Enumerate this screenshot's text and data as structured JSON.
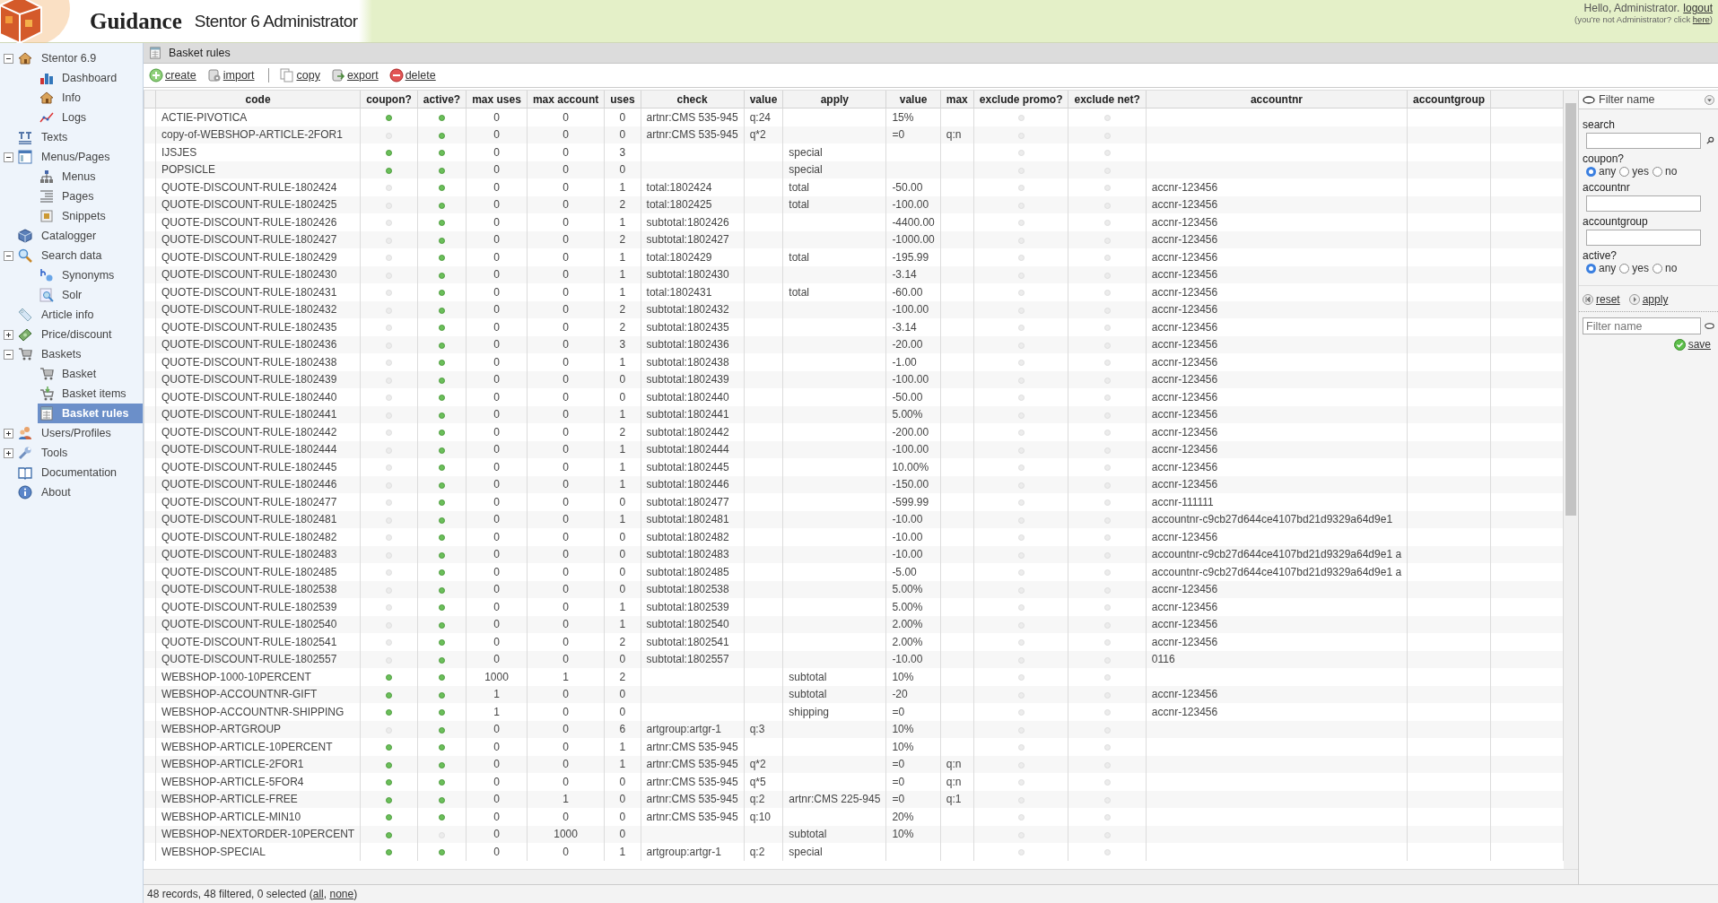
{
  "header": {
    "brand": "Guidance",
    "product": "Stentor 6 Administrator",
    "greeting": "Hello, Administrator.",
    "logout": "logout",
    "switch_user": {
      "before": "(you're not Administrator? click ",
      "link": "here",
      "after": ")"
    }
  },
  "sidebar": {
    "items": [
      {
        "label": "Stentor 6.9",
        "expanded": true,
        "children": [
          {
            "label": "Dashboard",
            "selected": false
          },
          {
            "label": "Info",
            "selected": false
          },
          {
            "label": "Logs",
            "selected": false
          }
        ]
      },
      {
        "label": "Texts"
      },
      {
        "label": "Menus/Pages",
        "expanded": true,
        "children": [
          {
            "label": "Menus",
            "selected": false
          },
          {
            "label": "Pages",
            "selected": false
          },
          {
            "label": "Snippets",
            "selected": false
          }
        ]
      },
      {
        "label": "Catalogger"
      },
      {
        "label": "Search data",
        "expanded": true,
        "children": [
          {
            "label": "Synonyms",
            "selected": false
          },
          {
            "label": "Solr",
            "selected": false
          }
        ]
      },
      {
        "label": "Article info"
      },
      {
        "label": "Price/discount",
        "expanded": false
      },
      {
        "label": "Baskets",
        "expanded": true,
        "children": [
          {
            "label": "Basket",
            "selected": false
          },
          {
            "label": "Basket items",
            "selected": false
          },
          {
            "label": "Basket rules",
            "selected": true
          }
        ]
      },
      {
        "label": "Users/Profiles",
        "expanded": false
      },
      {
        "label": "Tools",
        "expanded": false
      },
      {
        "label": "Documentation"
      },
      {
        "label": "About"
      }
    ]
  },
  "page": {
    "title": "Basket rules"
  },
  "toolbar": {
    "groups": [
      {
        "items": [
          {
            "label": "create"
          },
          {
            "label": "import"
          }
        ]
      },
      {
        "items": [
          {
            "label": "copy"
          },
          {
            "label": "export"
          },
          {
            "label": "delete"
          }
        ]
      }
    ]
  },
  "table": {
    "columns": [
      "code",
      "coupon?",
      "active?",
      "max uses",
      "max account",
      "uses",
      "check",
      "value",
      "apply",
      "value",
      "max",
      "exclude promo?",
      "exclude net?",
      "accountnr",
      "accountgroup"
    ],
    "rows": [
      {
        "code": "ACTIE-PIVOTICA",
        "coupon": true,
        "active": true,
        "max_uses": "0",
        "max_account": "0",
        "uses": "0",
        "check": "artnr:CMS 535-945",
        "value": "q:24",
        "apply_value": "15%",
        "exclude_promo": false,
        "exclude_net": false
      },
      {
        "code": "copy-of-WEBSHOP-ARTICLE-2FOR1",
        "coupon": false,
        "active": true,
        "max_uses": "0",
        "max_account": "0",
        "uses": "0",
        "check": "artnr:CMS 535-945",
        "value": "q*2",
        "apply_value": "=0",
        "max": "q:n",
        "exclude_promo": false,
        "exclude_net": false
      },
      {
        "code": "IJSJES",
        "coupon": true,
        "active": true,
        "max_uses": "0",
        "max_account": "0",
        "uses": "3",
        "apply": "special",
        "exclude_promo": false,
        "exclude_net": false
      },
      {
        "code": "POPSICLE",
        "coupon": true,
        "active": true,
        "max_uses": "0",
        "max_account": "0",
        "uses": "0",
        "apply": "special",
        "exclude_promo": false,
        "exclude_net": false
      },
      {
        "code": "QUOTE-DISCOUNT-RULE-1802424",
        "coupon": false,
        "active": true,
        "max_uses": "0",
        "max_account": "0",
        "uses": "1",
        "check": "total:1802424",
        "apply": "total",
        "apply_value": "-50.00",
        "exclude_promo": false,
        "exclude_net": false,
        "accountnr": "accnr-123456"
      },
      {
        "code": "QUOTE-DISCOUNT-RULE-1802425",
        "coupon": false,
        "active": true,
        "max_uses": "0",
        "max_account": "0",
        "uses": "2",
        "check": "total:1802425",
        "apply": "total",
        "apply_value": "-100.00",
        "exclude_promo": false,
        "exclude_net": false,
        "accountnr": "accnr-123456"
      },
      {
        "code": "QUOTE-DISCOUNT-RULE-1802426",
        "coupon": false,
        "active": true,
        "max_uses": "0",
        "max_account": "0",
        "uses": "1",
        "check": "subtotal:1802426",
        "apply_value": "-4400.00",
        "exclude_promo": false,
        "exclude_net": false,
        "accountnr": "accnr-123456"
      },
      {
        "code": "QUOTE-DISCOUNT-RULE-1802427",
        "coupon": false,
        "active": true,
        "max_uses": "0",
        "max_account": "0",
        "uses": "2",
        "check": "subtotal:1802427",
        "apply_value": "-1000.00",
        "exclude_promo": false,
        "exclude_net": false,
        "accountnr": "accnr-123456"
      },
      {
        "code": "QUOTE-DISCOUNT-RULE-1802429",
        "coupon": false,
        "active": true,
        "max_uses": "0",
        "max_account": "0",
        "uses": "1",
        "check": "total:1802429",
        "apply": "total",
        "apply_value": "-195.99",
        "exclude_promo": false,
        "exclude_net": false,
        "accountnr": "accnr-123456"
      },
      {
        "code": "QUOTE-DISCOUNT-RULE-1802430",
        "coupon": false,
        "active": true,
        "max_uses": "0",
        "max_account": "0",
        "uses": "1",
        "check": "subtotal:1802430",
        "apply_value": "-3.14",
        "exclude_promo": false,
        "exclude_net": false,
        "accountnr": "accnr-123456"
      },
      {
        "code": "QUOTE-DISCOUNT-RULE-1802431",
        "coupon": false,
        "active": true,
        "max_uses": "0",
        "max_account": "0",
        "uses": "1",
        "check": "total:1802431",
        "apply": "total",
        "apply_value": "-60.00",
        "exclude_promo": false,
        "exclude_net": false,
        "accountnr": "accnr-123456"
      },
      {
        "code": "QUOTE-DISCOUNT-RULE-1802432",
        "coupon": false,
        "active": true,
        "max_uses": "0",
        "max_account": "0",
        "uses": "2",
        "check": "subtotal:1802432",
        "apply_value": "-100.00",
        "exclude_promo": false,
        "exclude_net": false,
        "accountnr": "accnr-123456"
      },
      {
        "code": "QUOTE-DISCOUNT-RULE-1802435",
        "coupon": false,
        "active": true,
        "max_uses": "0",
        "max_account": "0",
        "uses": "2",
        "check": "subtotal:1802435",
        "apply_value": "-3.14",
        "exclude_promo": false,
        "exclude_net": false,
        "accountnr": "accnr-123456"
      },
      {
        "code": "QUOTE-DISCOUNT-RULE-1802436",
        "coupon": false,
        "active": true,
        "max_uses": "0",
        "max_account": "0",
        "uses": "3",
        "check": "subtotal:1802436",
        "apply_value": "-20.00",
        "exclude_promo": false,
        "exclude_net": false,
        "accountnr": "accnr-123456"
      },
      {
        "code": "QUOTE-DISCOUNT-RULE-1802438",
        "coupon": false,
        "active": true,
        "max_uses": "0",
        "max_account": "0",
        "uses": "1",
        "check": "subtotal:1802438",
        "apply_value": "-1.00",
        "exclude_promo": false,
        "exclude_net": false,
        "accountnr": "accnr-123456"
      },
      {
        "code": "QUOTE-DISCOUNT-RULE-1802439",
        "coupon": false,
        "active": true,
        "max_uses": "0",
        "max_account": "0",
        "uses": "0",
        "check": "subtotal:1802439",
        "apply_value": "-100.00",
        "exclude_promo": false,
        "exclude_net": false,
        "accountnr": "accnr-123456"
      },
      {
        "code": "QUOTE-DISCOUNT-RULE-1802440",
        "coupon": false,
        "active": true,
        "max_uses": "0",
        "max_account": "0",
        "uses": "0",
        "check": "subtotal:1802440",
        "apply_value": "-50.00",
        "exclude_promo": false,
        "exclude_net": false,
        "accountnr": "accnr-123456"
      },
      {
        "code": "QUOTE-DISCOUNT-RULE-1802441",
        "coupon": false,
        "active": true,
        "max_uses": "0",
        "max_account": "0",
        "uses": "1",
        "check": "subtotal:1802441",
        "apply_value": "5.00%",
        "exclude_promo": false,
        "exclude_net": false,
        "accountnr": "accnr-123456"
      },
      {
        "code": "QUOTE-DISCOUNT-RULE-1802442",
        "coupon": false,
        "active": true,
        "max_uses": "0",
        "max_account": "0",
        "uses": "2",
        "check": "subtotal:1802442",
        "apply_value": "-200.00",
        "exclude_promo": false,
        "exclude_net": false,
        "accountnr": "accnr-123456"
      },
      {
        "code": "QUOTE-DISCOUNT-RULE-1802444",
        "coupon": false,
        "active": true,
        "max_uses": "0",
        "max_account": "0",
        "uses": "1",
        "check": "subtotal:1802444",
        "apply_value": "-100.00",
        "exclude_promo": false,
        "exclude_net": false,
        "accountnr": "accnr-123456"
      },
      {
        "code": "QUOTE-DISCOUNT-RULE-1802445",
        "coupon": false,
        "active": true,
        "max_uses": "0",
        "max_account": "0",
        "uses": "1",
        "check": "subtotal:1802445",
        "apply_value": "10.00%",
        "exclude_promo": false,
        "exclude_net": false,
        "accountnr": "accnr-123456"
      },
      {
        "code": "QUOTE-DISCOUNT-RULE-1802446",
        "coupon": false,
        "active": true,
        "max_uses": "0",
        "max_account": "0",
        "uses": "1",
        "check": "subtotal:1802446",
        "apply_value": "-150.00",
        "exclude_promo": false,
        "exclude_net": false,
        "accountnr": "accnr-123456"
      },
      {
        "code": "QUOTE-DISCOUNT-RULE-1802477",
        "coupon": false,
        "active": true,
        "max_uses": "0",
        "max_account": "0",
        "uses": "0",
        "check": "subtotal:1802477",
        "apply_value": "-599.99",
        "exclude_promo": false,
        "exclude_net": false,
        "accountnr": "accnr-111111"
      },
      {
        "code": "QUOTE-DISCOUNT-RULE-1802481",
        "coupon": false,
        "active": true,
        "max_uses": "0",
        "max_account": "0",
        "uses": "1",
        "check": "subtotal:1802481",
        "apply_value": "-10.00",
        "exclude_promo": false,
        "exclude_net": false,
        "accountnr": "accountnr-c9cb27d644ce4107bd21d9329a64d9e1"
      },
      {
        "code": "QUOTE-DISCOUNT-RULE-1802482",
        "coupon": false,
        "active": true,
        "max_uses": "0",
        "max_account": "0",
        "uses": "0",
        "check": "subtotal:1802482",
        "apply_value": "-10.00",
        "exclude_promo": false,
        "exclude_net": false,
        "accountnr": "accnr-123456"
      },
      {
        "code": "QUOTE-DISCOUNT-RULE-1802483",
        "coupon": false,
        "active": true,
        "max_uses": "0",
        "max_account": "0",
        "uses": "0",
        "check": "subtotal:1802483",
        "apply_value": "-10.00",
        "exclude_promo": false,
        "exclude_net": false,
        "accountnr": "accountnr-c9cb27d644ce4107bd21d9329a64d9e1 a"
      },
      {
        "code": "QUOTE-DISCOUNT-RULE-1802485",
        "coupon": false,
        "active": true,
        "max_uses": "0",
        "max_account": "0",
        "uses": "0",
        "check": "subtotal:1802485",
        "apply_value": "-5.00",
        "exclude_promo": false,
        "exclude_net": false,
        "accountnr": "accountnr-c9cb27d644ce4107bd21d9329a64d9e1 a"
      },
      {
        "code": "QUOTE-DISCOUNT-RULE-1802538",
        "coupon": false,
        "active": true,
        "max_uses": "0",
        "max_account": "0",
        "uses": "0",
        "check": "subtotal:1802538",
        "apply_value": "5.00%",
        "exclude_promo": false,
        "exclude_net": false,
        "accountnr": "accnr-123456"
      },
      {
        "code": "QUOTE-DISCOUNT-RULE-1802539",
        "coupon": false,
        "active": true,
        "max_uses": "0",
        "max_account": "0",
        "uses": "1",
        "check": "subtotal:1802539",
        "apply_value": "5.00%",
        "exclude_promo": false,
        "exclude_net": false,
        "accountnr": "accnr-123456"
      },
      {
        "code": "QUOTE-DISCOUNT-RULE-1802540",
        "coupon": false,
        "active": true,
        "max_uses": "0",
        "max_account": "0",
        "uses": "1",
        "check": "subtotal:1802540",
        "apply_value": "2.00%",
        "exclude_promo": false,
        "exclude_net": false,
        "accountnr": "accnr-123456"
      },
      {
        "code": "QUOTE-DISCOUNT-RULE-1802541",
        "coupon": false,
        "active": true,
        "max_uses": "0",
        "max_account": "0",
        "uses": "2",
        "check": "subtotal:1802541",
        "apply_value": "2.00%",
        "exclude_promo": false,
        "exclude_net": false,
        "accountnr": "accnr-123456"
      },
      {
        "code": "QUOTE-DISCOUNT-RULE-1802557",
        "coupon": false,
        "active": true,
        "max_uses": "0",
        "max_account": "0",
        "uses": "0",
        "check": "subtotal:1802557",
        "apply_value": "-10.00",
        "exclude_promo": false,
        "exclude_net": false,
        "accountnr": "0116"
      },
      {
        "code": "WEBSHOP-1000-10PERCENT",
        "coupon": true,
        "active": true,
        "max_uses": "1000",
        "max_account": "1",
        "uses": "2",
        "apply": "subtotal",
        "apply_value": "10%",
        "exclude_promo": false,
        "exclude_net": false
      },
      {
        "code": "WEBSHOP-ACCOUNTNR-GIFT",
        "coupon": true,
        "active": true,
        "max_uses": "1",
        "max_account": "0",
        "uses": "0",
        "apply": "subtotal",
        "apply_value": "-20",
        "exclude_promo": false,
        "exclude_net": false,
        "accountnr": "accnr-123456"
      },
      {
        "code": "WEBSHOP-ACCOUNTNR-SHIPPING",
        "coupon": true,
        "active": true,
        "max_uses": "1",
        "max_account": "0",
        "uses": "0",
        "apply": "shipping",
        "apply_value": "=0",
        "exclude_promo": false,
        "exclude_net": false,
        "accountnr": "accnr-123456"
      },
      {
        "code": "WEBSHOP-ARTGROUP",
        "coupon": false,
        "active": true,
        "max_uses": "0",
        "max_account": "0",
        "uses": "6",
        "check": "artgroup:artgr-1",
        "value": "q:3",
        "apply_value": "10%",
        "exclude_promo": false,
        "exclude_net": false
      },
      {
        "code": "WEBSHOP-ARTICLE-10PERCENT",
        "coupon": true,
        "active": true,
        "max_uses": "0",
        "max_account": "0",
        "uses": "1",
        "check": "artnr:CMS 535-945",
        "apply_value": "10%",
        "exclude_promo": false,
        "exclude_net": false
      },
      {
        "code": "WEBSHOP-ARTICLE-2FOR1",
        "coupon": true,
        "active": true,
        "max_uses": "0",
        "max_account": "0",
        "uses": "1",
        "check": "artnr:CMS 535-945",
        "value": "q*2",
        "apply_value": "=0",
        "max": "q:n",
        "exclude_promo": false,
        "exclude_net": false
      },
      {
        "code": "WEBSHOP-ARTICLE-5FOR4",
        "coupon": true,
        "active": true,
        "max_uses": "0",
        "max_account": "0",
        "uses": "0",
        "check": "artnr:CMS 535-945",
        "value": "q*5",
        "apply_value": "=0",
        "max": "q:n",
        "exclude_promo": false,
        "exclude_net": false
      },
      {
        "code": "WEBSHOP-ARTICLE-FREE",
        "coupon": true,
        "active": true,
        "max_uses": "0",
        "max_account": "1",
        "uses": "0",
        "check": "artnr:CMS 535-945",
        "value": "q:2",
        "apply": "artnr:CMS 225-945",
        "apply_value": "=0",
        "max": "q:1",
        "exclude_promo": false,
        "exclude_net": false
      },
      {
        "code": "WEBSHOP-ARTICLE-MIN10",
        "coupon": true,
        "active": true,
        "max_uses": "0",
        "max_account": "0",
        "uses": "0",
        "check": "artnr:CMS 535-945",
        "value": "q:10",
        "apply_value": "20%",
        "exclude_promo": false,
        "exclude_net": false
      },
      {
        "code": "WEBSHOP-NEXTORDER-10PERCENT",
        "coupon": true,
        "active": false,
        "max_uses": "0",
        "max_account": "1000",
        "uses": "0",
        "apply": "subtotal",
        "apply_value": "10%",
        "exclude_promo": false,
        "exclude_net": false
      },
      {
        "code": "WEBSHOP-SPECIAL",
        "coupon": true,
        "active": true,
        "max_uses": "0",
        "max_account": "0",
        "uses": "1",
        "check": "artgroup:artgr-1",
        "value": "q:2",
        "apply": "special",
        "exclude_promo": false,
        "exclude_net": false
      }
    ]
  },
  "filter": {
    "title": "Filter name",
    "fields": [
      {
        "kind": "search",
        "label": "search"
      },
      {
        "kind": "radio",
        "label": "coupon?",
        "options": [
          {
            "label": "any",
            "selected": true
          },
          {
            "label": "yes",
            "selected": false
          },
          {
            "label": "no",
            "selected": false
          }
        ]
      },
      {
        "kind": "text",
        "label": "accountnr"
      },
      {
        "kind": "text",
        "label": "accountgroup"
      },
      {
        "kind": "radio",
        "label": "active?",
        "options": [
          {
            "label": "any",
            "selected": true
          },
          {
            "label": "yes",
            "selected": false
          },
          {
            "label": "no",
            "selected": false
          }
        ]
      }
    ],
    "actions": [
      {
        "label": "reset"
      },
      {
        "label": "apply"
      }
    ],
    "save": {
      "placeholder": "Filter name",
      "button": "save"
    }
  },
  "status_bar": {
    "text": "48 records, 48 filtered, 0 selected (",
    "links": [
      "all",
      "none"
    ],
    "separator": ", ",
    "after": ")"
  }
}
